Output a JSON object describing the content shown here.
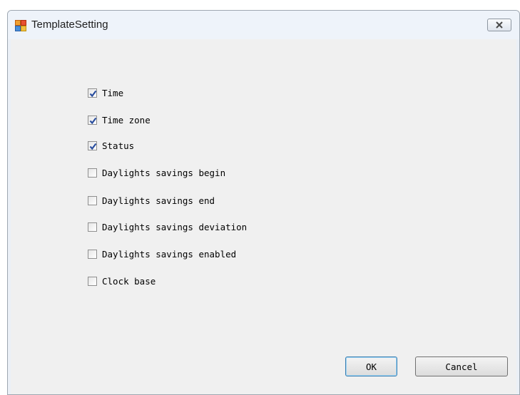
{
  "window": {
    "title": "TemplateSetting",
    "close_icon": "close-x-icon"
  },
  "options": [
    {
      "label": "Time",
      "checked": true
    },
    {
      "label": "Time zone",
      "checked": true
    },
    {
      "label": "Status",
      "checked": true
    },
    {
      "label": "Daylights savings begin",
      "checked": false
    },
    {
      "label": "Daylights savings end",
      "checked": false
    },
    {
      "label": "Daylights savings deviation",
      "checked": false
    },
    {
      "label": "Daylights savings enabled",
      "checked": false
    },
    {
      "label": "Clock base",
      "checked": false
    }
  ],
  "buttons": {
    "ok": "OK",
    "cancel": "Cancel"
  },
  "colors": {
    "check_mark": "#2a4e9e",
    "default_button_border": "#3c7fb1"
  }
}
